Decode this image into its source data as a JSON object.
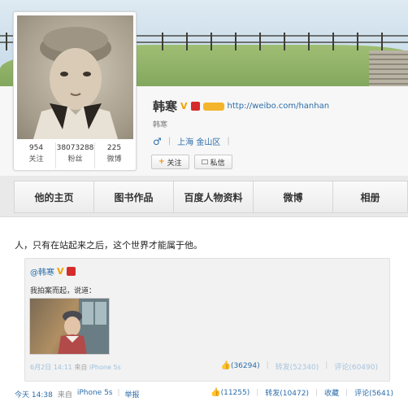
{
  "profile": {
    "name": "韩寒",
    "verified_badge": "V",
    "homepage_url": "http://weibo.com/hanhan",
    "subname": "韩寒",
    "gender_icon": "male-symbol",
    "location": "上海 金山区",
    "follow_label": "关注",
    "message_label": "私信",
    "stats": [
      {
        "num": "954",
        "label": "关注"
      },
      {
        "num": "38073288",
        "label": "粉丝"
      },
      {
        "num": "225",
        "label": "微博"
      }
    ]
  },
  "tabs": [
    "他的主页",
    "图书作品",
    "百度人物资料",
    "微博",
    "相册"
  ],
  "post": {
    "text": "人，只有在站起来之后，这个世界才能属于他。",
    "repost": {
      "author": "@韩寒",
      "badge": "V",
      "text": "我拍案而起，说道：",
      "time": "6月2日 14:11",
      "source_prefix": "来自",
      "source": "iPhone 5s",
      "likes": "(36294)",
      "forwards": "转发(52340)",
      "comments": "评论(60490)"
    },
    "meta": {
      "time": "今天 14:38",
      "source_prefix": "来自",
      "source": "iPhone 5s",
      "report": "举报"
    },
    "stats": {
      "likes": "(11255)",
      "forwards": "转发(10472)",
      "favorite": "收藏",
      "comments": "评论(5641)"
    }
  }
}
